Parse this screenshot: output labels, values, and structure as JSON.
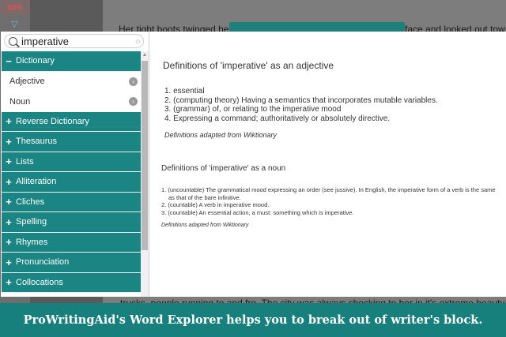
{
  "background": {
    "zoom": "50%",
    "line_top_left": "Her tight boots twinged her",
    "line_top_right": "face and looked out tow",
    "line_bottom": "trucks, people running to and fro. The city was always shocking to her in it's extreme beauty e"
  },
  "search": {
    "value": "imperative",
    "nav": "‹›"
  },
  "sidebar": {
    "items": [
      {
        "sign": "−",
        "label": "Dictionary"
      },
      {
        "sign": "",
        "label": "Adjective"
      },
      {
        "sign": "",
        "label": "Noun"
      },
      {
        "sign": "+",
        "label": "Reverse Dictionary"
      },
      {
        "sign": "+",
        "label": "Thesaurus"
      },
      {
        "sign": "+",
        "label": "Lists"
      },
      {
        "sign": "+",
        "label": "Alliteration"
      },
      {
        "sign": "+",
        "label": "Cliches"
      },
      {
        "sign": "+",
        "label": "Spelling"
      },
      {
        "sign": "+",
        "label": "Rhymes"
      },
      {
        "sign": "+",
        "label": "Pronunciation"
      },
      {
        "sign": "+",
        "label": "Collocations"
      }
    ]
  },
  "content": {
    "adjective_heading": "Definitions of 'imperative' as an adjective",
    "adjective_defs": [
      "1. essential",
      "2. (computing theory) Having a semantics that incorporates mutable variables.",
      "3. (grammar) of, or relating to the imperative mood",
      "4. Expressing a command; authoritatively or absolutely directive."
    ],
    "adjective_note": "Definitions adapted from Wiktionary",
    "noun_heading": "Definitions of 'imperative' as a noun",
    "noun_defs": [
      "1. (uncountable) The grammatical mood expressing an order (see jussive). In English, the imperative form of a verb is the same as that of the bare infinitive.",
      "2. (countable) A verb in imperative mood.",
      "3. (countable) An essential action, a must: something which is imperative."
    ],
    "noun_note": "Definitions adapted from Wiktionary"
  },
  "caption": "ProWritingAid's Word Explorer helps you to break out of writer's block."
}
